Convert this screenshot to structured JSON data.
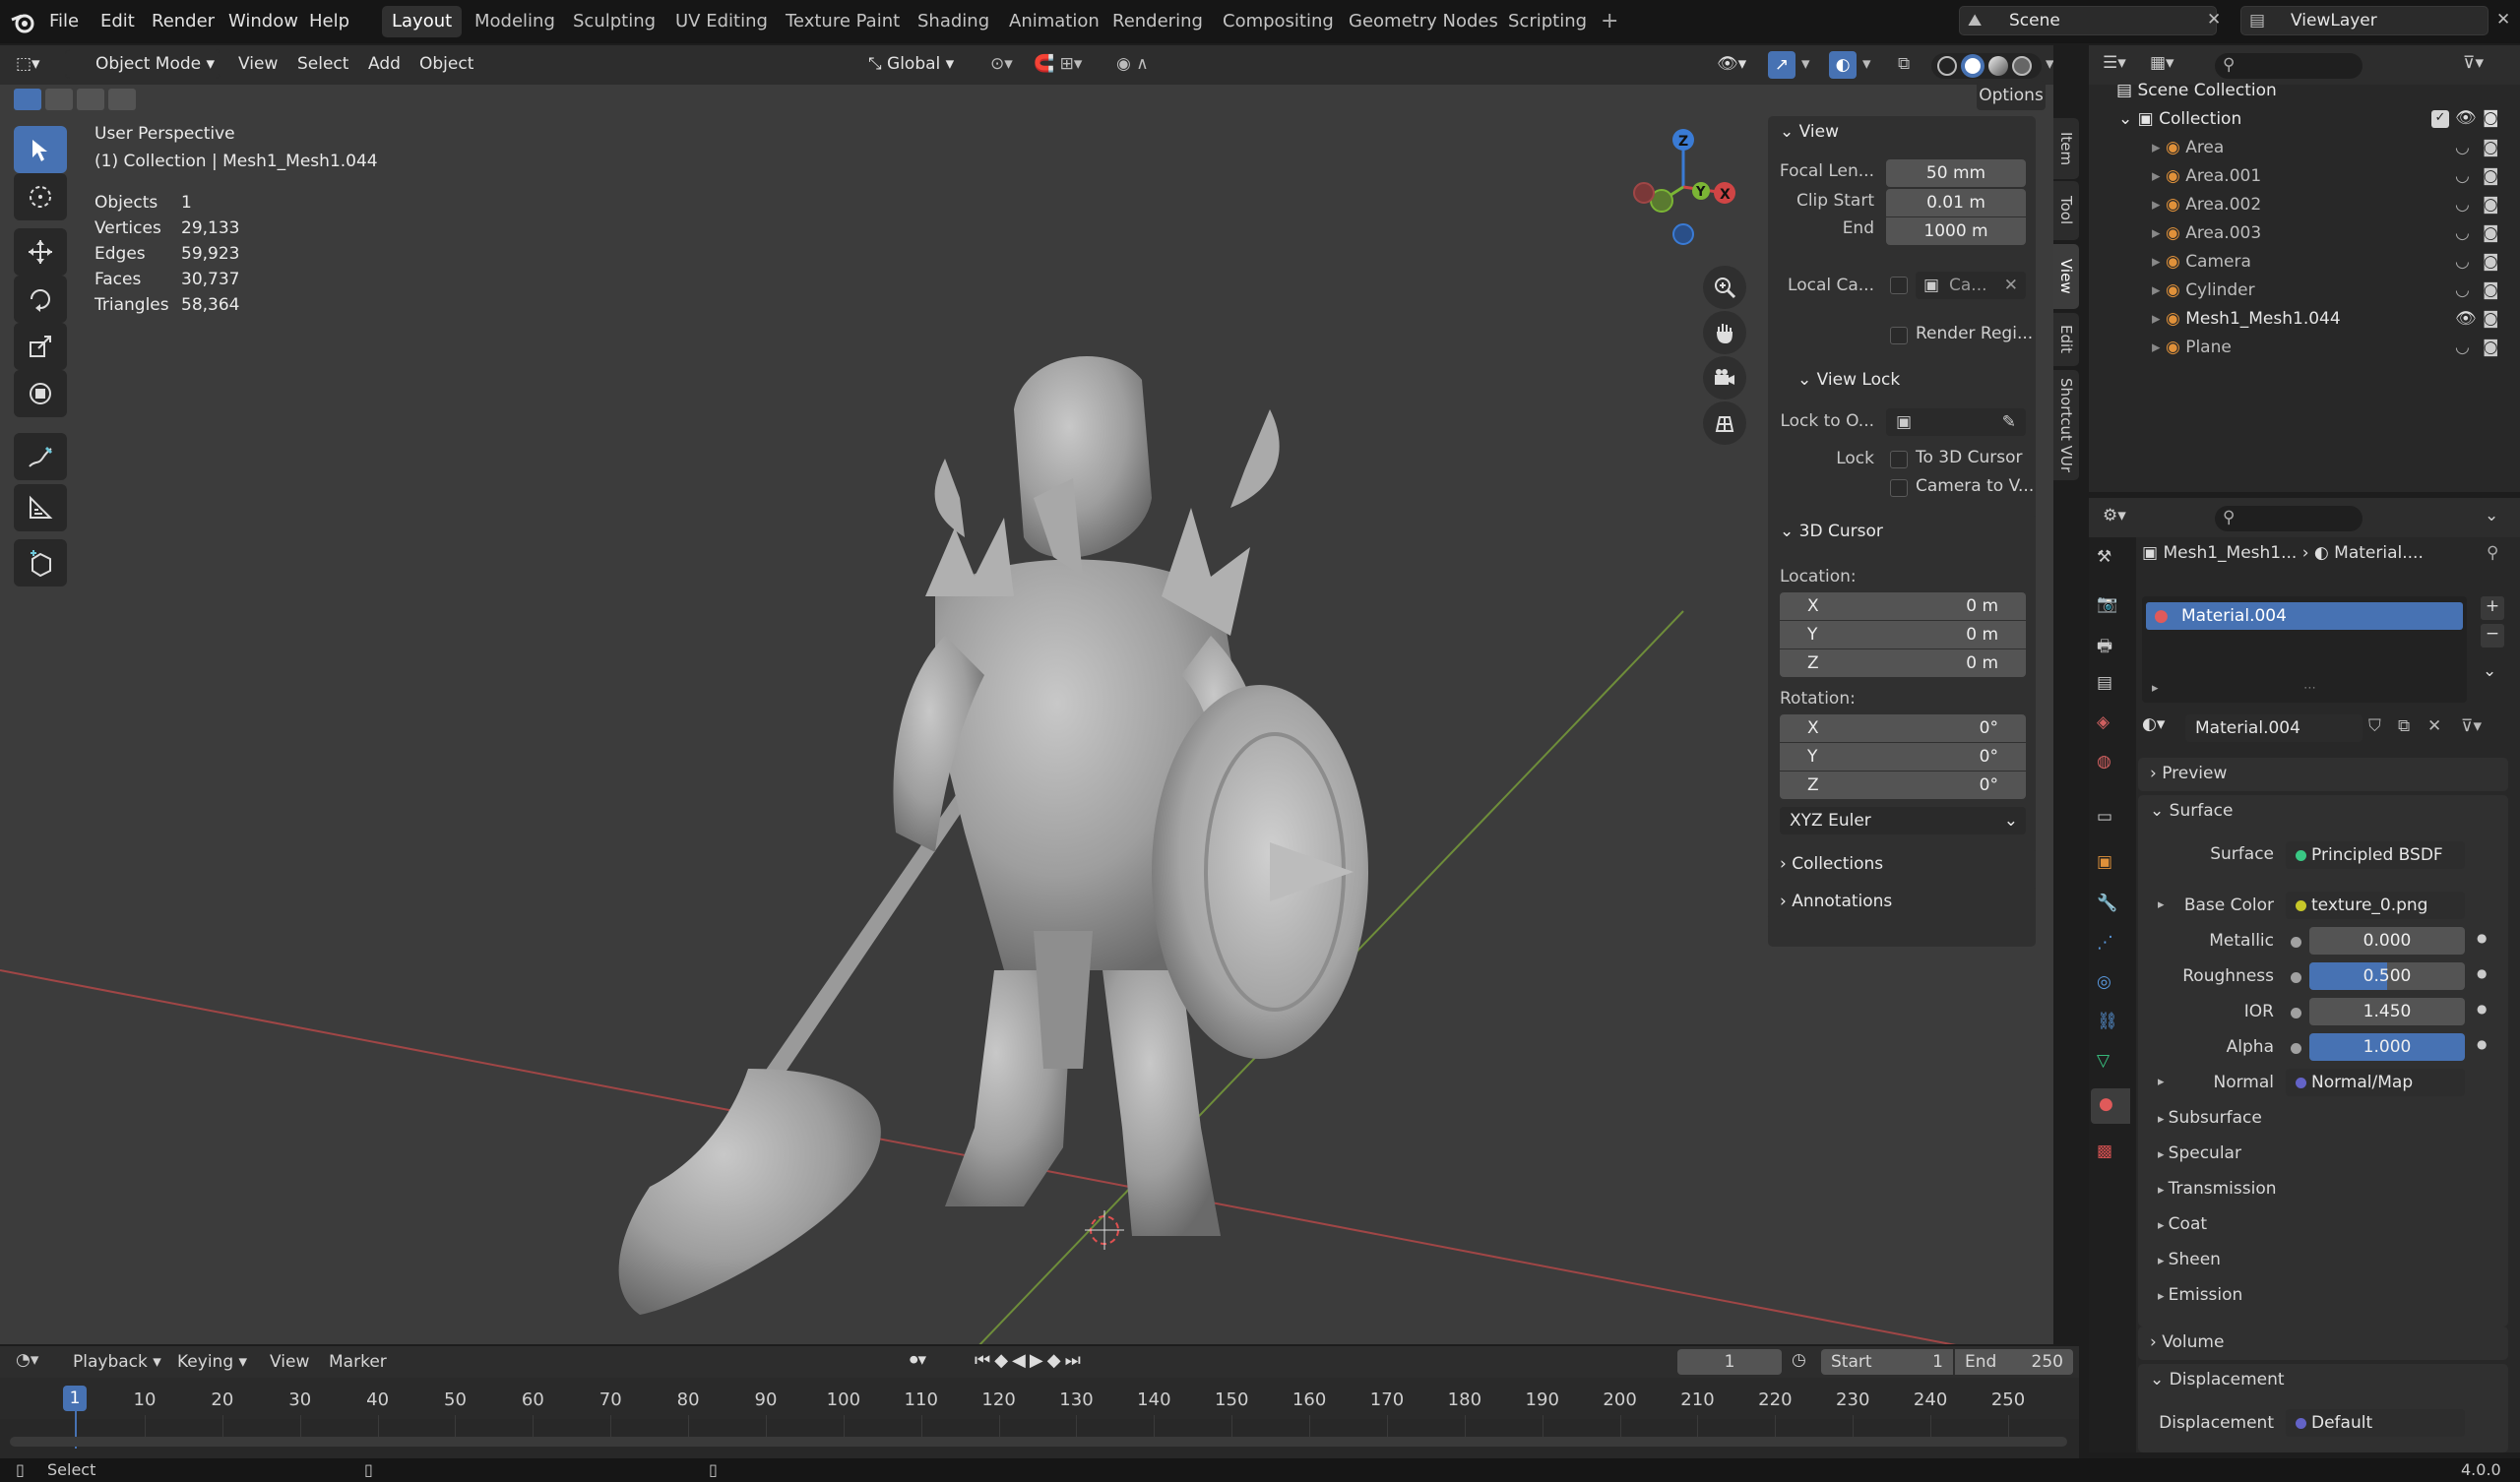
{
  "topbar": {
    "menus": [
      "File",
      "Edit",
      "Render",
      "Window",
      "Help"
    ],
    "workspaces": [
      "Layout",
      "Modeling",
      "Sculpting",
      "UV Editing",
      "Texture Paint",
      "Shading",
      "Animation",
      "Rendering",
      "Compositing",
      "Geometry Nodes",
      "Scripting"
    ],
    "active_workspace": "Layout",
    "scene": "Scene",
    "view_layer": "ViewLayer"
  },
  "viewport_header": {
    "mode": "Object Mode",
    "menus": [
      "View",
      "Select",
      "Add",
      "Object"
    ],
    "transform_orientation": "Global",
    "options_label": "Options"
  },
  "overlay": {
    "view_name": "User Perspective",
    "collection_info": "(1) Collection | Mesh1_Mesh1.044",
    "stats": [
      {
        "label": "Objects",
        "value": "1"
      },
      {
        "label": "Vertices",
        "value": "29,133"
      },
      {
        "label": "Edges",
        "value": "59,923"
      },
      {
        "label": "Faces",
        "value": "30,737"
      },
      {
        "label": "Triangles",
        "value": "58,364"
      }
    ]
  },
  "npanel": {
    "tabs": [
      "Item",
      "Tool",
      "View",
      "Edit",
      "Shortcut VUr"
    ],
    "view": {
      "title": "View",
      "focal_label": "Focal Len...",
      "focal_value": "50 mm",
      "clip_start_label": "Clip Start",
      "clip_start_value": "0.01 m",
      "end_label": "End",
      "end_value": "1000 m",
      "local_camera_label": "Local Ca...",
      "local_camera_value": "Ca...",
      "render_region_label": "Render Regi..."
    },
    "view_lock": {
      "title": "View Lock",
      "lock_to_label": "Lock to O...",
      "lock_label": "Lock",
      "to_cursor": "To 3D Cursor",
      "camera_to_view": "Camera to V..."
    },
    "cursor": {
      "title": "3D Cursor",
      "location_label": "Location:",
      "location": [
        {
          "axis": "X",
          "value": "0 m"
        },
        {
          "axis": "Y",
          "value": "0 m"
        },
        {
          "axis": "Z",
          "value": "0 m"
        }
      ],
      "rotation_label": "Rotation:",
      "rotation": [
        {
          "axis": "X",
          "value": "0°"
        },
        {
          "axis": "Y",
          "value": "0°"
        },
        {
          "axis": "Z",
          "value": "0°"
        }
      ],
      "rotation_mode": "XYZ Euler"
    },
    "collections": "Collections",
    "annotations": "Annotations"
  },
  "outliner": {
    "scene_collection": "Scene Collection",
    "collection": "Collection",
    "items": [
      "Area",
      "Area.001",
      "Area.002",
      "Area.003",
      "Camera",
      "Cylinder",
      "Mesh1_Mesh1.044",
      "Plane"
    ]
  },
  "properties": {
    "breadcrumb_object": "Mesh1_Mesh1...",
    "breadcrumb_material": "Material....",
    "slot": "Material.004",
    "material_name": "Material.004",
    "preview": "Preview",
    "surface_header": "Surface",
    "surface_label": "Surface",
    "surface_value": "Principled BSDF",
    "base_color_label": "Base Color",
    "base_color_value": "texture_0.png",
    "metallic_label": "Metallic",
    "metallic_value": "0.000",
    "roughness_label": "Roughness",
    "roughness_value": "0.500",
    "ior_label": "IOR",
    "ior_value": "1.450",
    "alpha_label": "Alpha",
    "alpha_value": "1.000",
    "normal_label": "Normal",
    "normal_value": "Normal/Map",
    "subpanels": [
      "Subsurface",
      "Specular",
      "Transmission",
      "Coat",
      "Sheen",
      "Emission"
    ],
    "volume": "Volume",
    "displacement_header": "Displacement",
    "displacement_label": "Displacement",
    "displacement_value": "Default",
    "colors": {
      "accent": "#4772b3",
      "base_color_socket": "#c7c729",
      "shader_socket": "#39c884",
      "vector_socket": "#6363c7",
      "float_socket": "#a1a1a1"
    }
  },
  "timeline": {
    "menus": [
      "Playback",
      "Keying",
      "View",
      "Marker"
    ],
    "current_frame": "1",
    "start_label": "Start",
    "start_value": "1",
    "end_label": "End",
    "end_value": "250",
    "ticks": [
      "10",
      "20",
      "30",
      "40",
      "50",
      "60",
      "70",
      "80",
      "90",
      "100",
      "110",
      "120",
      "130",
      "140",
      "150",
      "160",
      "170",
      "180",
      "190",
      "200",
      "210",
      "220",
      "230",
      "240",
      "250"
    ]
  },
  "statusbar": {
    "left": "Select",
    "version": "4.0.0"
  }
}
